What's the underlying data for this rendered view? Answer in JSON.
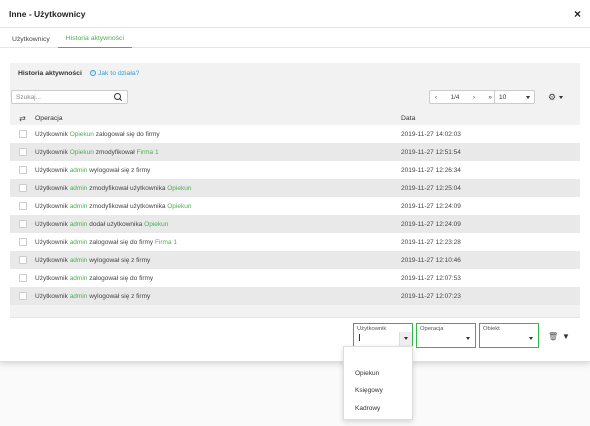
{
  "window": {
    "title": "Inne - Użytkownicy",
    "close_icon": "×"
  },
  "tabs": [
    {
      "label": "Użytkownicy",
      "active": false
    },
    {
      "label": "Historia aktywności",
      "active": true
    }
  ],
  "panel": {
    "title": "Historia aktywności",
    "help_label": "Jak to działa?"
  },
  "search": {
    "placeholder": "Szukaj..."
  },
  "pager": {
    "first": "‹",
    "page": "1/4",
    "next": "›",
    "last": "»",
    "per_page": "10"
  },
  "table": {
    "col_operation": "Operacja",
    "col_date": "Data",
    "rows": [
      {
        "parts": [
          "Użytkownik ",
          "Opiekun",
          " zalogował się do firmy"
        ],
        "date": "2019-11-27 14:02:03"
      },
      {
        "parts": [
          "Użytkownik ",
          "Opiekun",
          " zmodyfikował ",
          "Firma 1"
        ],
        "date": "2019-11-27 12:51:54"
      },
      {
        "parts": [
          "Użytkownik ",
          "admin",
          " wylogował się z firmy"
        ],
        "date": "2019-11-27 12:26:34"
      },
      {
        "parts": [
          "Użytkownik ",
          "admin",
          " zmodyfikował użytkownika ",
          "Opiekun"
        ],
        "date": "2019-11-27 12:25:04"
      },
      {
        "parts": [
          "Użytkownik ",
          "admin",
          " zmodyfikował użytkownika ",
          "Opiekun"
        ],
        "date": "2019-11-27 12:24:09"
      },
      {
        "parts": [
          "Użytkownik ",
          "admin",
          " dodał użytkownika ",
          "Opiekun"
        ],
        "date": "2019-11-27 12:24:09"
      },
      {
        "parts": [
          "Użytkownik ",
          "admin",
          " zalogował się do firmy ",
          "Firma 1"
        ],
        "date": "2019-11-27 12:23:28"
      },
      {
        "parts": [
          "Użytkownik ",
          "admin",
          " wylogował się z firmy"
        ],
        "date": "2019-11-27 12:10:46"
      },
      {
        "parts": [
          "Użytkownik ",
          "admin",
          " zalogował się do firmy"
        ],
        "date": "2019-11-27 12:07:53"
      },
      {
        "parts": [
          "Użytkownik ",
          "admin",
          " wylogował się z firmy"
        ],
        "date": "2019-11-27 12:07:23"
      }
    ]
  },
  "filters": {
    "user_label": "Użytkownik",
    "operation_label": "Operacja",
    "object_label": "Obiekt"
  },
  "dropdown_options": [
    "Opiekun",
    "Księgowy",
    "Kadrowy"
  ],
  "colors": {
    "accent": "#4caf50",
    "focus_border": "#2eb84a",
    "link": "#2b9fd8"
  }
}
